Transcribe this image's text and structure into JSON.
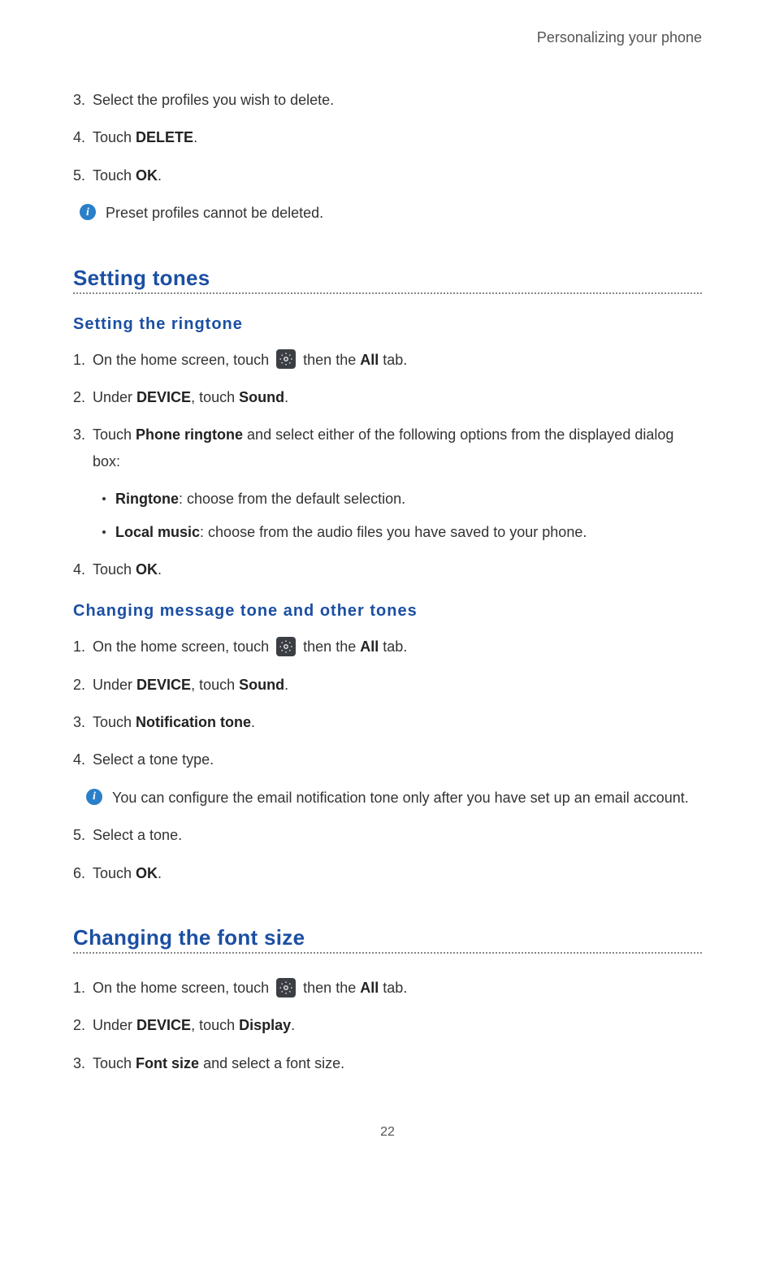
{
  "header": {
    "title": "Personalizing your phone"
  },
  "steps_top": [
    {
      "num": "3.",
      "text": "Select the profiles you wish to delete."
    },
    {
      "num": "4.",
      "prefix": "Touch ",
      "bold": "DELETE",
      "suffix": "."
    },
    {
      "num": "5.",
      "prefix": "Touch ",
      "bold": "OK",
      "suffix": "."
    }
  ],
  "info_top": "Preset profiles cannot be deleted.",
  "section_tones": {
    "title": "Setting tones",
    "sub_ringtone": {
      "title": "Setting  the  ringtone",
      "step1_a": "On the home screen, touch ",
      "step1_b": " then the ",
      "step1_bold": "All",
      "step1_c": " tab.",
      "step2_a": "Under ",
      "step2_b1": "DEVICE",
      "step2_b": ", touch ",
      "step2_b2": "Sound",
      "step2_c": ".",
      "step3_a": "Touch ",
      "step3_b": "Phone ringtone",
      "step3_c": " and select either of the following options from the displayed dialog box:",
      "bullets": [
        {
          "bold": "Ringtone",
          "text": ": choose from the default selection."
        },
        {
          "bold": "Local music",
          "text": ": choose from the audio files you have saved to your phone."
        }
      ],
      "step4_a": "Touch ",
      "step4_b": "OK",
      "step4_c": "."
    },
    "sub_message": {
      "title": "Changing  message  tone  and  other  tones",
      "step1_a": "On the home screen, touch ",
      "step1_b": " then the ",
      "step1_bold": "All",
      "step1_c": " tab.",
      "step2_a": "Under ",
      "step2_b1": "DEVICE",
      "step2_b": ", touch ",
      "step2_b2": "Sound",
      "step2_c": ".",
      "step3_a": "Touch ",
      "step3_b": "Notification tone",
      "step3_c": ".",
      "step4": "Select a tone type.",
      "info": "You can configure the email notification tone only after you have set up an email account.",
      "step5": "Select a tone.",
      "step6_a": "Touch ",
      "step6_b": "OK",
      "step6_c": "."
    }
  },
  "section_font": {
    "title": "Changing the font size",
    "step1_a": "On the home screen, touch ",
    "step1_b": " then the ",
    "step1_bold": "All",
    "step1_c": " tab.",
    "step2_a": "Under ",
    "step2_b1": "DEVICE",
    "step2_b": ", touch ",
    "step2_b2": "Display",
    "step2_c": ".",
    "step3_a": "Touch ",
    "step3_b": "Font size",
    "step3_c": " and select a font size."
  },
  "page_number": "22",
  "icons": {
    "info_glyph": "i"
  }
}
